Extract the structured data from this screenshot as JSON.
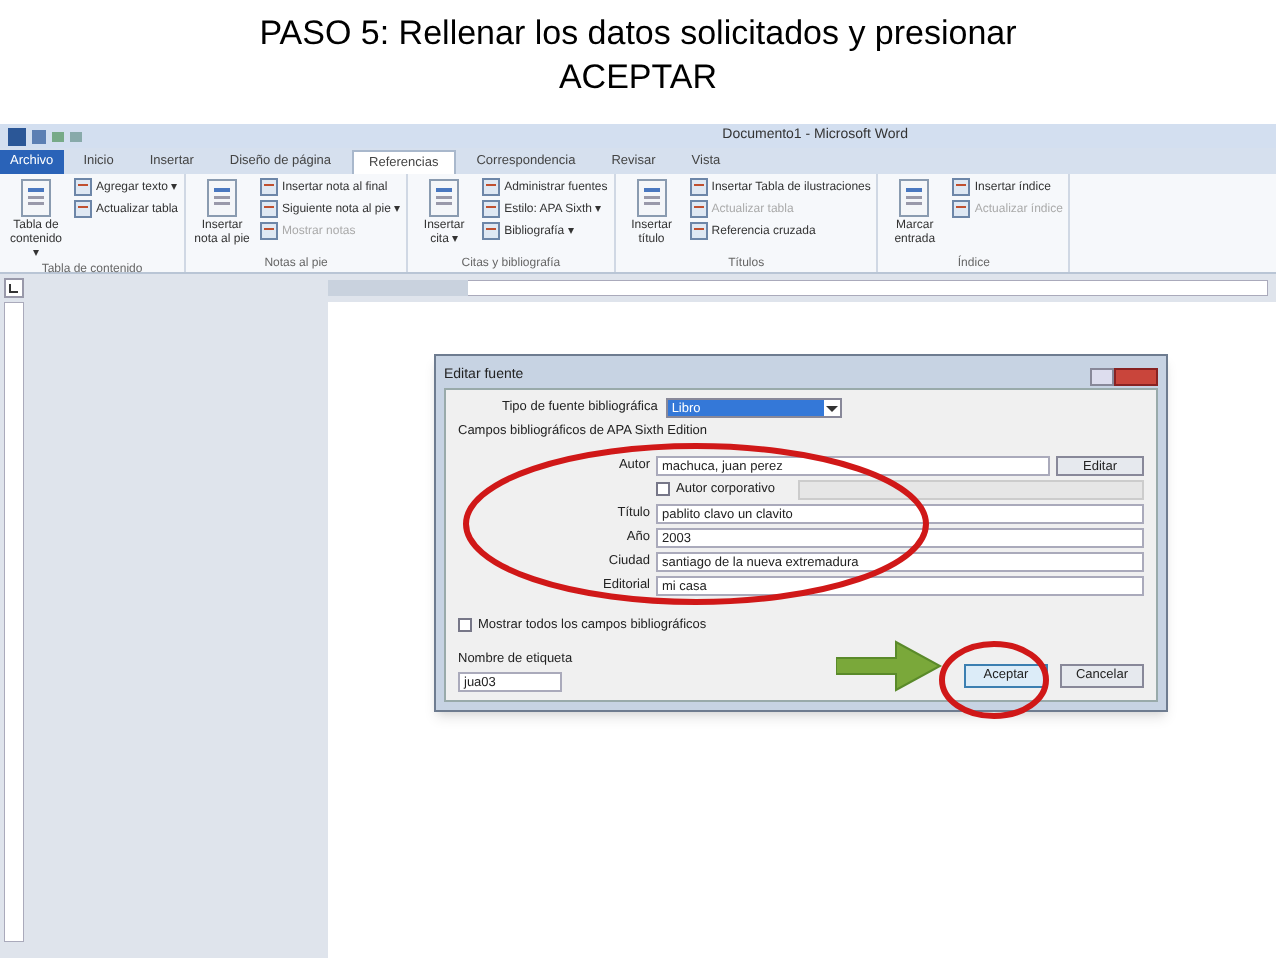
{
  "slide_title": "PASO 5: Rellenar los datos solicitados y presionar ACEPTAR",
  "window": {
    "title": "Documento1 - Microsoft Word"
  },
  "tabs": [
    {
      "label": "Archivo",
      "kind": "file",
      "selected": false
    },
    {
      "label": "Inicio",
      "kind": "tab",
      "selected": false
    },
    {
      "label": "Insertar",
      "kind": "tab",
      "selected": false
    },
    {
      "label": "Diseño de página",
      "kind": "tab",
      "selected": false
    },
    {
      "label": "Referencias",
      "kind": "tab",
      "selected": true
    },
    {
      "label": "Correspondencia",
      "kind": "tab",
      "selected": false
    },
    {
      "label": "Revisar",
      "kind": "tab",
      "selected": false
    },
    {
      "label": "Vista",
      "kind": "tab",
      "selected": false
    }
  ],
  "ribbon": [
    {
      "label": "Tabla de contenido",
      "items": [
        {
          "kind": "large",
          "label": "Tabla de contenido ▾",
          "disabled": false
        },
        {
          "kind": "small",
          "label": "Agregar texto ▾",
          "disabled": false
        },
        {
          "kind": "small",
          "label": "Actualizar tabla",
          "disabled": false
        }
      ]
    },
    {
      "label": "Notas al pie",
      "items": [
        {
          "kind": "large",
          "label": "Insertar nota al pie",
          "disabled": false
        },
        {
          "kind": "small",
          "label": "Insertar nota al final",
          "disabled": false
        },
        {
          "kind": "small",
          "label": "Siguiente nota al pie ▾",
          "disabled": false
        },
        {
          "kind": "small",
          "label": "Mostrar notas",
          "disabled": true
        }
      ]
    },
    {
      "label": "Citas y bibliografía",
      "items": [
        {
          "kind": "large",
          "label": "Insertar cita ▾",
          "disabled": false
        },
        {
          "kind": "small",
          "label": "Administrar fuentes",
          "disabled": false
        },
        {
          "kind": "small",
          "label": "Estilo: APA Sixth ▾",
          "disabled": false
        },
        {
          "kind": "small",
          "label": "Bibliografía ▾",
          "disabled": false
        }
      ]
    },
    {
      "label": "Títulos",
      "items": [
        {
          "kind": "large",
          "label": "Insertar título",
          "disabled": false
        },
        {
          "kind": "small",
          "label": "Insertar Tabla de ilustraciones",
          "disabled": false
        },
        {
          "kind": "small",
          "label": "Actualizar tabla",
          "disabled": true
        },
        {
          "kind": "small",
          "label": "Referencia cruzada",
          "disabled": false
        }
      ]
    },
    {
      "label": "Índice",
      "items": [
        {
          "kind": "large",
          "label": "Marcar entrada",
          "disabled": false
        },
        {
          "kind": "small",
          "label": "Insertar índice",
          "disabled": false
        },
        {
          "kind": "small",
          "label": "Actualizar índice",
          "disabled": true
        }
      ]
    }
  ],
  "dialog": {
    "title": "Editar fuente",
    "source_type_label": "Tipo de fuente bibliográfica",
    "source_type_value": "Libro",
    "fields_heading": "Campos bibliográficos de APA Sixth Edition",
    "fields": [
      {
        "kind": "text",
        "label": "Autor",
        "value": "machuca, juan perez",
        "button": "Editar"
      },
      {
        "kind": "checkbox",
        "label": "Autor corporativo",
        "checked": false
      },
      {
        "kind": "text",
        "label": "Título",
        "value": "pablito clavo un clavito"
      },
      {
        "kind": "text",
        "label": "Año",
        "value": "2003"
      },
      {
        "kind": "text",
        "label": "Ciudad",
        "value": "santiago de la nueva extremadura"
      },
      {
        "kind": "text",
        "label": "Editorial",
        "value": "mi casa"
      }
    ],
    "show_all": {
      "label": "Mostrar todos los campos bibliográficos",
      "checked": false
    },
    "tag_label": "Nombre de etiqueta",
    "tag_value": "jua03",
    "buttons": [
      "Aceptar",
      "Cancelar"
    ]
  }
}
